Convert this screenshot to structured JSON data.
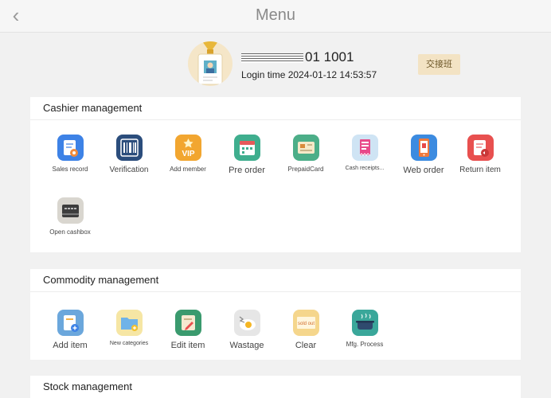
{
  "header": {
    "title": "Menu",
    "back_glyph": "‹"
  },
  "user": {
    "name_suffix": "01 1001",
    "login_time": "Login time 2024-01-12 14:53:57",
    "shift_button": "交接班"
  },
  "sections": {
    "cashier": {
      "title": "Cashier management",
      "items": [
        {
          "label": "Sales record"
        },
        {
          "label": "Verification"
        },
        {
          "label": "Add member",
          "badge": "VIP"
        },
        {
          "label": "Pre order"
        },
        {
          "label": "PrepaidCard"
        },
        {
          "label": "Cash receipts..."
        },
        {
          "label": "Web order"
        },
        {
          "label": "Return item"
        },
        {
          "label": "Open cashbox"
        }
      ]
    },
    "commodity": {
      "title": "Commodity management",
      "items": [
        {
          "label": "Add item"
        },
        {
          "label": "New categories"
        },
        {
          "label": "Edit item"
        },
        {
          "label": "Wastage"
        },
        {
          "label": "Clear",
          "badge": "sold out"
        },
        {
          "label": "Mfg. Process"
        }
      ]
    },
    "stock": {
      "title": "Stock management"
    }
  }
}
